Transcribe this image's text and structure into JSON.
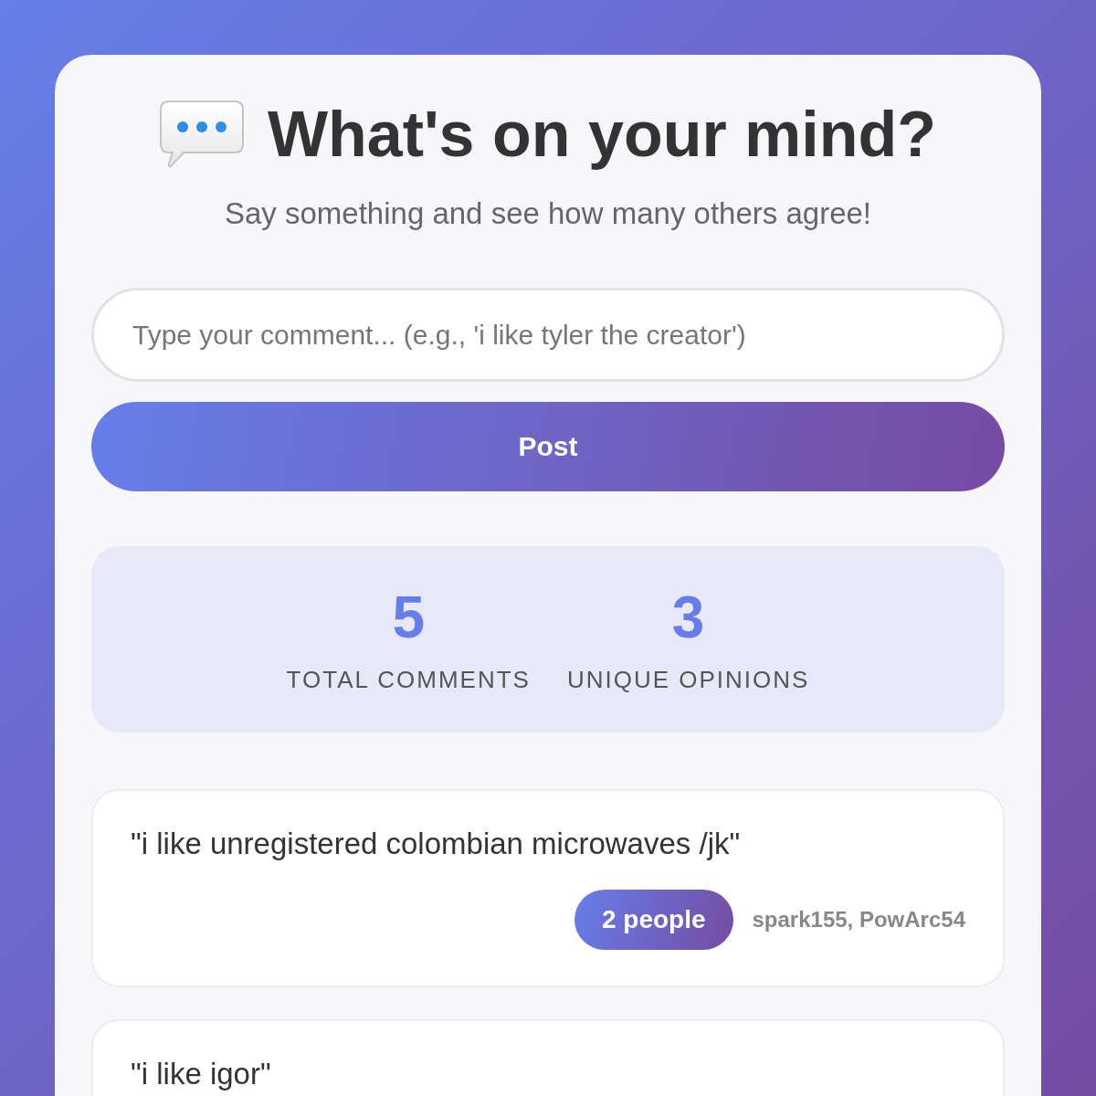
{
  "header": {
    "title": "What's on your mind?",
    "subtitle": "Say something and see how many others agree!"
  },
  "comment_input": {
    "placeholder": "Type your comment... (e.g., 'i like tyler the creator')"
  },
  "post_button": {
    "label": "Post"
  },
  "stats": [
    {
      "value": "5",
      "label": "TOTAL COMMENTS"
    },
    {
      "value": "3",
      "label": "UNIQUE OPINIONS"
    }
  ],
  "comments": [
    {
      "text": "\"i like unregistered colombian microwaves /jk\"",
      "count": "2 people",
      "users": "spark155, PowArc54"
    },
    {
      "text": "\"i like igor\""
    }
  ]
}
